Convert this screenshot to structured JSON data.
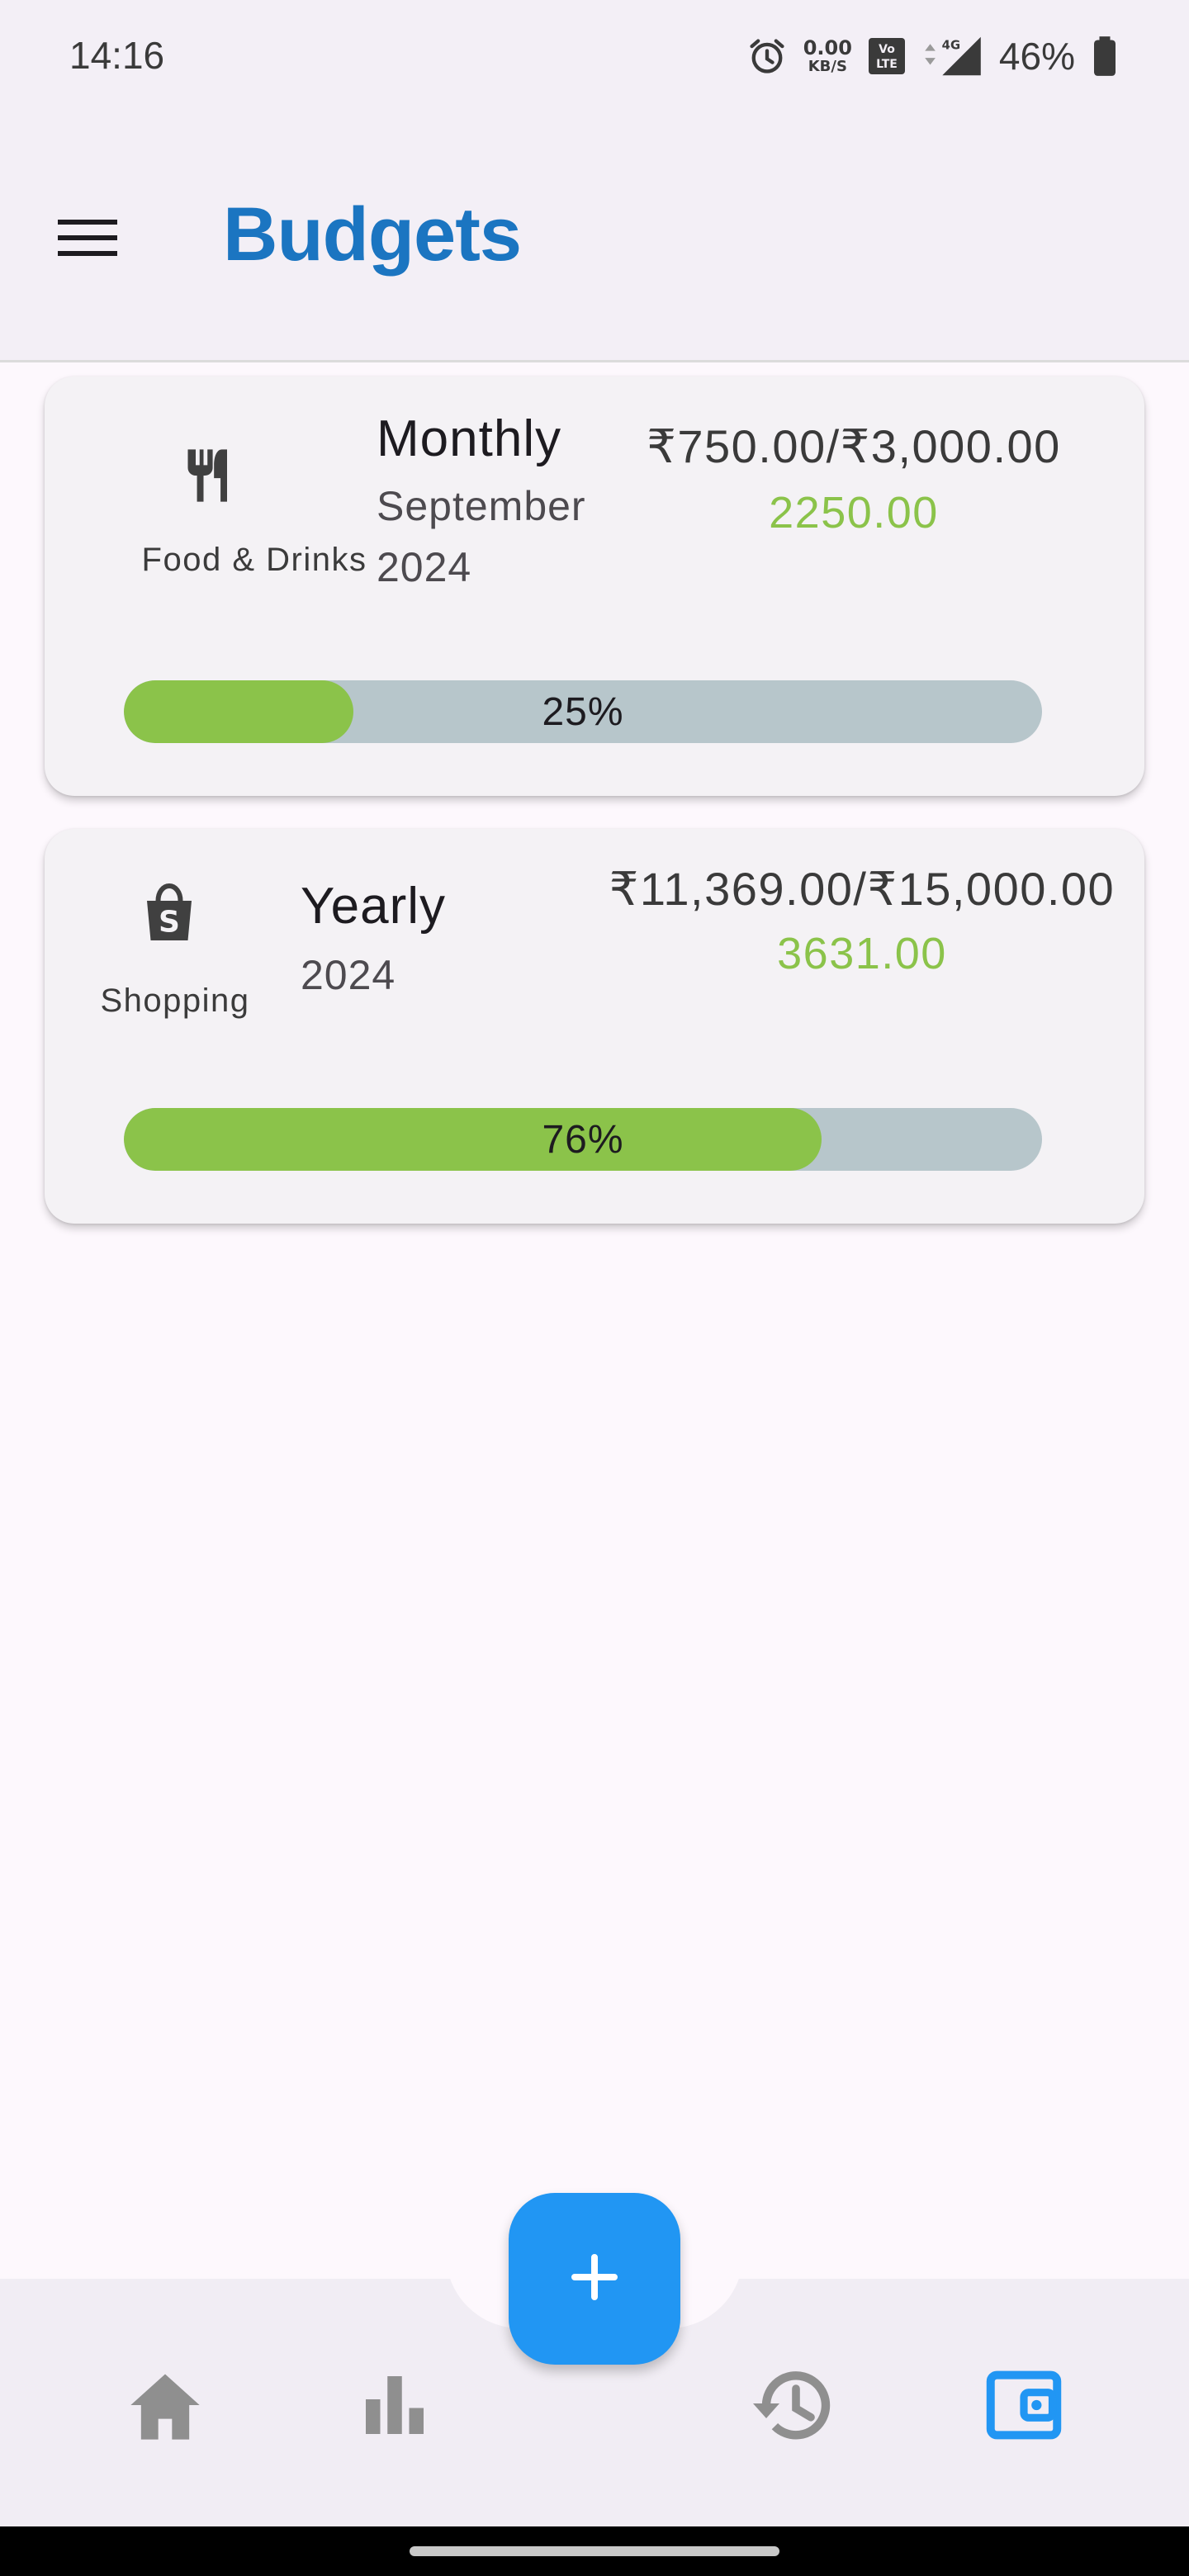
{
  "status_bar": {
    "time": "14:16",
    "net_speed_value": "0.00",
    "net_speed_unit": "KB/S",
    "network_type": "4G",
    "battery": "46%"
  },
  "app_bar": {
    "title": "Budgets",
    "menu_icon": "hamburger-menu-icon"
  },
  "budgets": [
    {
      "category": "Food & Drinks",
      "icon": "fork-knife-icon",
      "period": "Monthly",
      "period_sub_line1": "September",
      "period_sub_line2": "2024",
      "amount": "₹750.00/₹3,000.00",
      "remaining": "2250.00",
      "progress_label": "25%",
      "progress_fraction": 0.25
    },
    {
      "category": "Shopping",
      "icon": "shopping-bag-icon",
      "period": "Yearly",
      "period_sub_line1": "2024",
      "amount": "₹11,369.00/₹15,000.00",
      "remaining": "3631.00",
      "progress_label": "76%",
      "progress_fraction": 0.76
    }
  ],
  "bottom_nav": {
    "items": [
      "home-icon",
      "stats-icon",
      "history-icon",
      "wallet-icon"
    ],
    "active": "wallet-icon",
    "fab_icon": "plus-icon"
  },
  "colors": {
    "accent": "#1b75c1",
    "fab": "#2196f3",
    "progress_fill": "#8bc34a",
    "progress_track": "#b7c6cb",
    "remaining_text": "#8bc34a",
    "nav_inactive": "#8f8f8f"
  }
}
